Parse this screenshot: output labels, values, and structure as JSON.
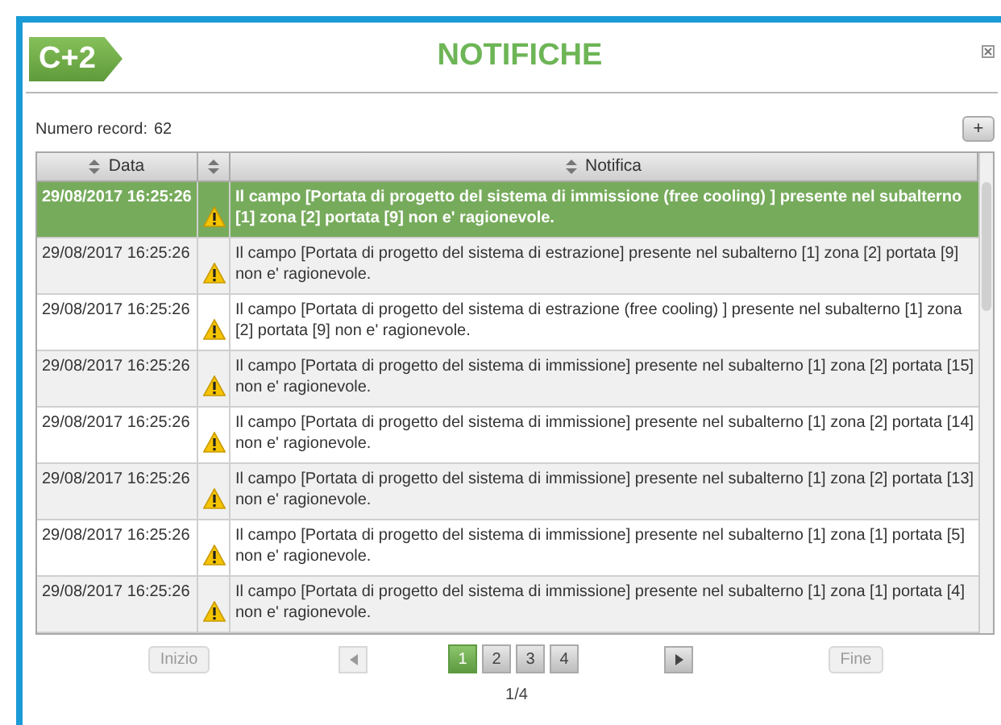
{
  "header": {
    "logo": "C+2",
    "title": "NOTIFICHE"
  },
  "record_count": {
    "label": "Numero record:",
    "value": "62"
  },
  "add_button": {
    "label": "+"
  },
  "table": {
    "columns": [
      "Data",
      "",
      "Notifica"
    ],
    "rows": [
      {
        "date": "29/08/2017 16:25:26",
        "message": "Il campo [Portata di progetto del sistema di immissione (free cooling) ] presente nel subalterno [1] zona [2] portata [9] non e' ragionevole.",
        "selected": true
      },
      {
        "date": "29/08/2017 16:25:26",
        "message": "Il campo [Portata di progetto del sistema di estrazione] presente nel subalterno [1] zona [2] portata [9] non e' ragionevole.",
        "selected": false
      },
      {
        "date": "29/08/2017 16:25:26",
        "message": "Il campo [Portata di progetto del sistema di estrazione (free cooling) ] presente nel subalterno [1] zona [2] portata [9] non e' ragionevole.",
        "selected": false
      },
      {
        "date": "29/08/2017 16:25:26",
        "message": "Il campo [Portata di progetto del sistema di immissione] presente nel subalterno [1] zona [2] portata [15] non e' ragionevole.",
        "selected": false
      },
      {
        "date": "29/08/2017 16:25:26",
        "message": "Il campo [Portata di progetto del sistema di immissione] presente nel subalterno [1] zona [2] portata [14] non e' ragionevole.",
        "selected": false
      },
      {
        "date": "29/08/2017 16:25:26",
        "message": "Il campo [Portata di progetto del sistema di immissione] presente nel subalterno [1] zona [2] portata [13] non e' ragionevole.",
        "selected": false
      },
      {
        "date": "29/08/2017 16:25:26",
        "message": "Il campo [Portata di progetto del sistema di immissione] presente nel subalterno [1] zona [1] portata [5] non e' ragionevole.",
        "selected": false
      },
      {
        "date": "29/08/2017 16:25:26",
        "message": "Il campo [Portata di progetto del sistema di immissione] presente nel subalterno [1] zona [1] portata [4] non e' ragionevole.",
        "selected": false
      }
    ]
  },
  "pagination": {
    "first": {
      "label": "Inizio",
      "disabled": true
    },
    "prev": {
      "disabled": true
    },
    "pages": [
      {
        "label": "1",
        "selected": true
      },
      {
        "label": "2",
        "selected": false
      },
      {
        "label": "3",
        "selected": false
      },
      {
        "label": "4",
        "selected": false
      }
    ],
    "next": {
      "disabled": false
    },
    "last": {
      "label": "Fine",
      "disabled": true
    },
    "summary": "1/4"
  }
}
